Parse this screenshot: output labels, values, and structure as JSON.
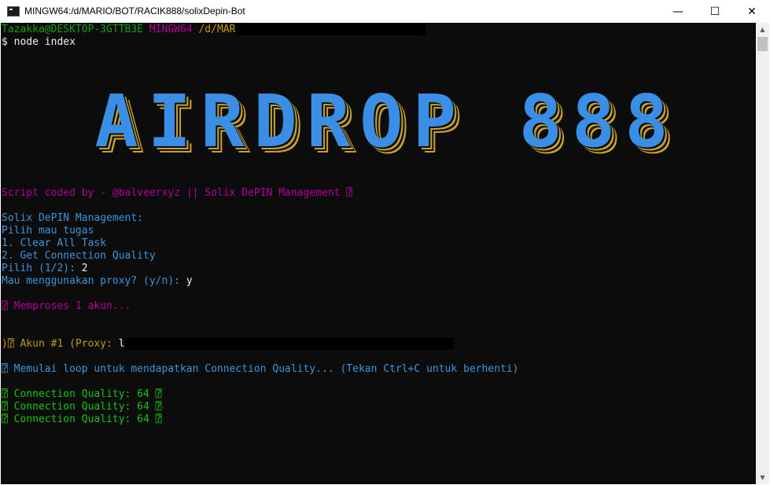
{
  "window": {
    "title": "MINGW64:/d/MARIO/BOT/RACIK888/solixDepin-Bot",
    "minimize": "—",
    "maximize": "☐",
    "close": "✕"
  },
  "colors": {
    "terminal_bg": "#0c0c0c",
    "banner_fill": "#3b8ee6",
    "banner_outline": "#c9a227",
    "purple": "#b4009e",
    "green": "#16c60c",
    "blue": "#3a96dd",
    "yellow": "#c19c00"
  },
  "prompt": {
    "user_host": "Tazakka@DESKTOP-3GTTB3E",
    "shell": "MINGW64",
    "path": "/d/MAR",
    "command": "$ node index"
  },
  "banner": "AIRDROP 888",
  "lines": {
    "credit": "Script coded by - @balveerxyz || Solix DePIN Management ⍰",
    "menu_title": "Solix DePIN Management:",
    "menu_prompt": "Pilih mau tugas",
    "option1": "1. Clear All Task",
    "option2": "2. Get Connection Quality",
    "choice_label": "Pilih (1/2): ",
    "choice_value": "2",
    "proxy_label": "Mau menggunakan proxy? (y/n): ",
    "proxy_value": "y",
    "processing": "⍰ Memproses 1 akun...",
    "account": ")⍰ Akun #1 (Proxy: ",
    "account_cursor": "l",
    "loop": "⍰ Memulai loop untuk mendapatkan Connection Quality... (Tekan Ctrl+C untuk berhenti)",
    "quality": [
      "⍰ Connection Quality: 64 ⍰",
      "⍰ Connection Quality: 64 ⍰",
      "⍰ Connection Quality: 64 ⍰"
    ]
  }
}
